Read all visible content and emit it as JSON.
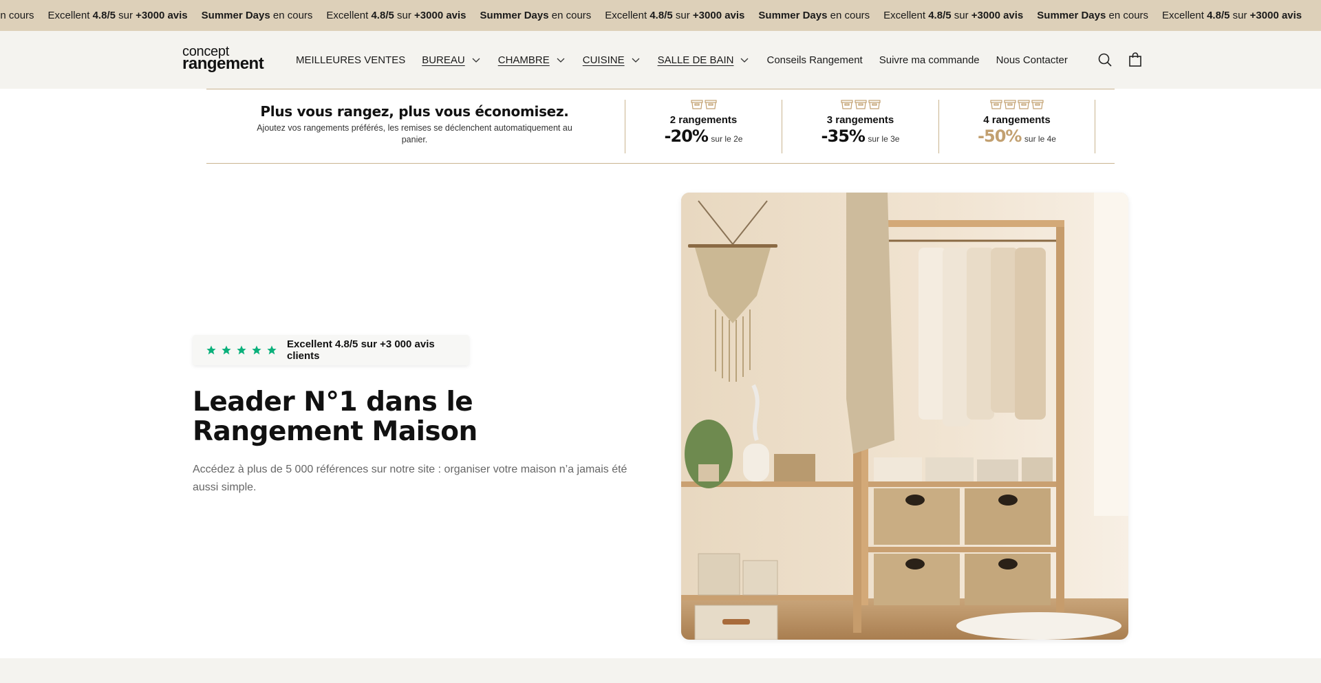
{
  "marquee": {
    "items": [
      {
        "pre": "",
        "bold": "",
        "post": "en cours",
        "kind": "tail"
      },
      {
        "pre": "Excellent ",
        "bold": "4.8/5",
        "mid": " sur ",
        "bold2": "+3000 avis",
        "kind": "rating"
      },
      {
        "pre": "",
        "bold": "Summer Days",
        "post": " en cours",
        "kind": "promo"
      },
      {
        "pre": "Excellent ",
        "bold": "4.8/5",
        "mid": " sur ",
        "bold2": "+3000 avis",
        "kind": "rating"
      },
      {
        "pre": "",
        "bold": "Summer Days",
        "post": " en cours",
        "kind": "promo"
      },
      {
        "pre": "Excellent ",
        "bold": "4.8/5",
        "mid": " sur ",
        "bold2": "+3000 avis",
        "kind": "rating"
      },
      {
        "pre": "",
        "bold": "Summer Days",
        "post": " en cours",
        "kind": "promo"
      },
      {
        "pre": "Excellent ",
        "bold": "4.8/5",
        "mid": " sur ",
        "bold2": "+3000 avis",
        "kind": "rating"
      },
      {
        "pre": "",
        "bold": "Summer Days",
        "post": " en cours",
        "kind": "promo"
      },
      {
        "pre": "Excellent ",
        "bold": "4.8/5",
        "mid": " sur ",
        "bold2": "+3000 avis",
        "kind": "rating"
      }
    ]
  },
  "header": {
    "logo_line1": "concept",
    "logo_line2": "rangement",
    "nav": [
      {
        "label": "MEILLEURES VENTES",
        "dropdown": false,
        "underline": false,
        "name": "nav-meilleures-ventes"
      },
      {
        "label": "BUREAU",
        "dropdown": true,
        "underline": true,
        "name": "nav-bureau"
      },
      {
        "label": "CHAMBRE",
        "dropdown": true,
        "underline": true,
        "name": "nav-chambre"
      },
      {
        "label": "CUISINE",
        "dropdown": true,
        "underline": true,
        "name": "nav-cuisine"
      },
      {
        "label": "SALLE DE BAIN",
        "dropdown": true,
        "underline": true,
        "name": "nav-salle-de-bain"
      },
      {
        "label": "Conseils Rangement",
        "dropdown": false,
        "underline": false,
        "name": "nav-conseils-rangement"
      },
      {
        "label": "Suivre ma commande",
        "dropdown": false,
        "underline": false,
        "name": "nav-suivre-commande"
      },
      {
        "label": "Nous Contacter",
        "dropdown": false,
        "underline": false,
        "name": "nav-nous-contacter"
      }
    ],
    "icons": [
      "search-icon",
      "shopping-bag-icon"
    ]
  },
  "promo": {
    "title": "Plus vous rangez, plus vous économisez.",
    "subtitle": "Ajoutez vos rangements préférés, les remises se déclenchent automatiquement au panier.",
    "tiers": [
      {
        "name": "2 rangements",
        "percent": "-20%",
        "note": "sur le 2e",
        "boxes": 2,
        "highlight": false
      },
      {
        "name": "3 rangements",
        "percent": "-35%",
        "note": "sur le 3e",
        "boxes": 3,
        "highlight": false
      },
      {
        "name": "4 rangements",
        "percent": "-50%",
        "note": "sur le 4e",
        "boxes": 4,
        "highlight": true
      }
    ]
  },
  "hero": {
    "rating_stars": 5,
    "rating_text": "Excellent 4.8/5 sur +3 000 avis clients",
    "title": "Leader N°1 dans le Rangement Maison",
    "description": "Accédez à plus de 5 000 références sur notre site : organiser votre maison n’a jamais été aussi simple."
  },
  "colors": {
    "marquee_bg": "#ddd0b9",
    "header_bg": "#f4f3ef",
    "accent_gold": "#c2a070",
    "star_green": "#0bb07b"
  }
}
